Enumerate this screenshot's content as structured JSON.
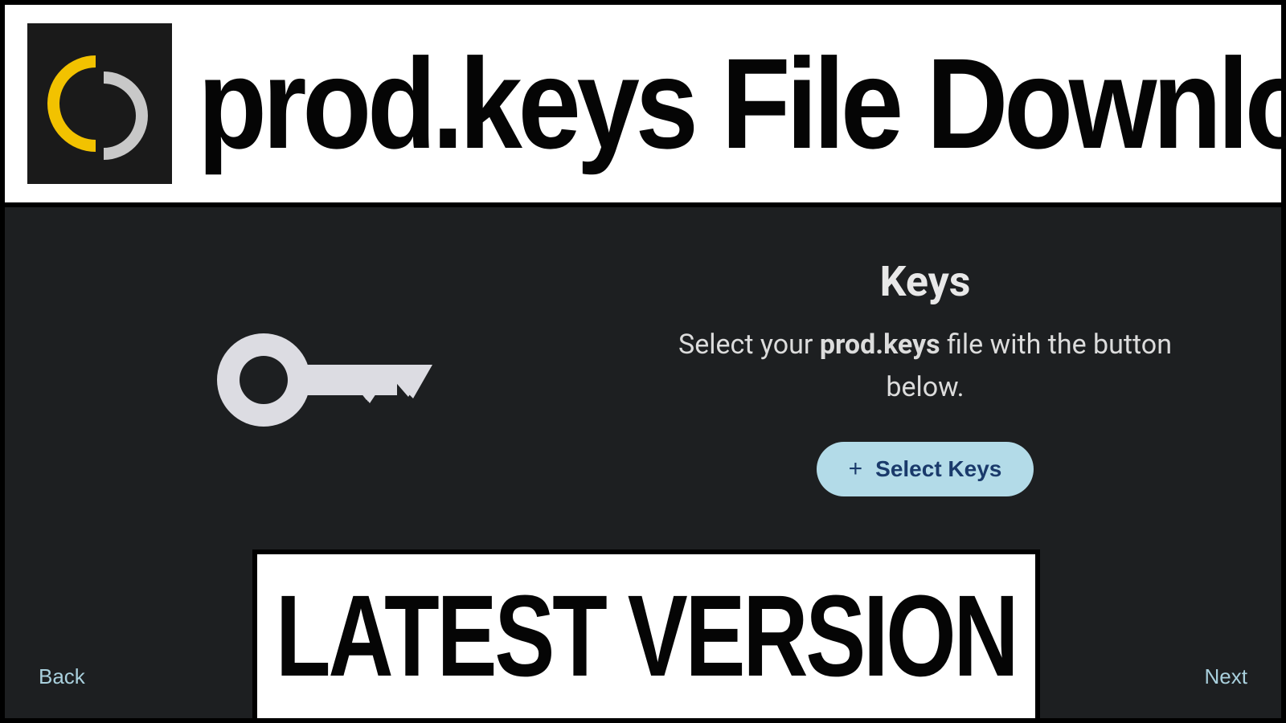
{
  "banner": {
    "title": "prod.keys File Download"
  },
  "main": {
    "heading": "Keys",
    "instruction_pre": "Select your ",
    "instruction_bold": "prod.keys",
    "instruction_post": " file with the button below.",
    "select_button": "Select Keys",
    "back": "Back",
    "next": "Next"
  },
  "footer": {
    "label": "LATEST VERSION"
  }
}
